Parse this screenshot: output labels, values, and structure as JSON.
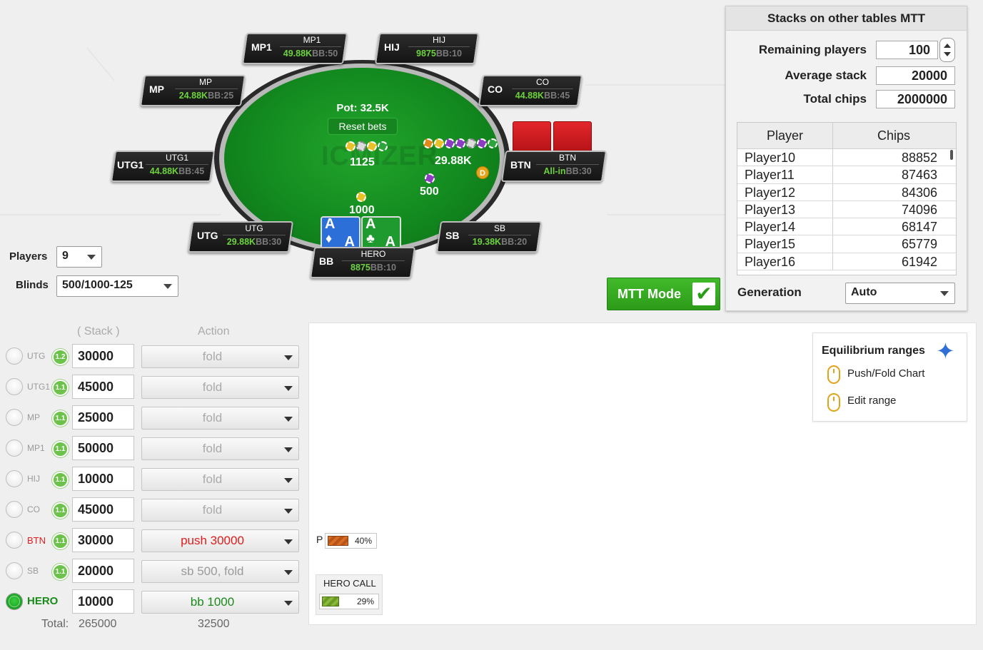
{
  "table": {
    "pot_label": "Pot: 32.5K",
    "reset_label": "Reset bets",
    "logo_text": "ICMIZER",
    "bets": {
      "utg1_area": "1125",
      "btn": "29.88K",
      "sb": "500",
      "bb": "1000"
    },
    "dealer": "D",
    "hero_cards": [
      {
        "rank": "A",
        "suit": "♦",
        "color": "#2d6fd9"
      },
      {
        "rank": "A",
        "suit": "♣",
        "color": "#1f9a2e"
      }
    ]
  },
  "seats": [
    {
      "pos": "MP1",
      "name": "MP1",
      "stack": "49.88K",
      "bb": "BB:50"
    },
    {
      "pos": "HIJ",
      "name": "HIJ",
      "stack": "9875",
      "bb": "BB:10"
    },
    {
      "pos": "MP",
      "name": "MP",
      "stack": "24.88K",
      "bb": "BB:25"
    },
    {
      "pos": "CO",
      "name": "CO",
      "stack": "44.88K",
      "bb": "BB:45"
    },
    {
      "pos": "UTG1",
      "name": "UTG1",
      "stack": "44.88K",
      "bb": "BB:45"
    },
    {
      "pos": "BTN",
      "name": "BTN",
      "stack": "All-in",
      "bb": "BB:30"
    },
    {
      "pos": "UTG",
      "name": "UTG",
      "stack": "29.88K",
      "bb": "BB:30"
    },
    {
      "pos": "SB",
      "name": "SB",
      "stack": "19.38K",
      "bb": "BB:20"
    },
    {
      "pos": "BB",
      "name": "HERO",
      "stack": "8875",
      "bb": "BB:10"
    }
  ],
  "controls": {
    "players_label": "Players",
    "players_value": "9",
    "blinds_label": "Blinds",
    "blinds_value": "500/1000-125",
    "mtt_label": "MTT Mode",
    "mtt_check": "✔"
  },
  "stacks_panel": {
    "title": "Stacks on other tables MTT",
    "remaining_label": "Remaining players",
    "remaining_value": "100",
    "average_label": "Average stack",
    "average_value": "20000",
    "total_label": "Total chips",
    "total_value": "2000000",
    "col_player": "Player",
    "col_chips": "Chips",
    "rows": [
      {
        "player": "Player10",
        "chips": "88852"
      },
      {
        "player": "Player11",
        "chips": "87463"
      },
      {
        "player": "Player12",
        "chips": "84306"
      },
      {
        "player": "Player13",
        "chips": "74096"
      },
      {
        "player": "Player14",
        "chips": "68147"
      },
      {
        "player": "Player15",
        "chips": "65779"
      },
      {
        "player": "Player16",
        "chips": "61942"
      }
    ],
    "generation_label": "Generation",
    "generation_value": "Auto"
  },
  "player_rows": {
    "col_stack": "Stack",
    "col_action": "Action",
    "rows": [
      {
        "pos": "UTG",
        "mult": "1.2",
        "stack": "30000",
        "action": "fold"
      },
      {
        "pos": "UTG1",
        "mult": "1.1",
        "stack": "45000",
        "action": "fold"
      },
      {
        "pos": "MP",
        "mult": "1.1",
        "stack": "25000",
        "action": "fold"
      },
      {
        "pos": "MP1",
        "mult": "1.1",
        "stack": "50000",
        "action": "fold"
      },
      {
        "pos": "HIJ",
        "mult": "1.1",
        "stack": "10000",
        "action": "fold"
      },
      {
        "pos": "CO",
        "mult": "1.1",
        "stack": "45000",
        "action": "fold"
      },
      {
        "pos": "BTN",
        "mult": "1.1",
        "stack": "30000",
        "action": "push 30000"
      },
      {
        "pos": "SB",
        "mult": "1.1",
        "stack": "20000",
        "action": "sb 500, fold"
      },
      {
        "pos": "HERO",
        "mult": "",
        "stack": "10000",
        "action": "bb 1000"
      }
    ],
    "total_label": "Total:",
    "total_stack": "265000",
    "total_action": "32500"
  },
  "ranges": {
    "eq_title": "Equilibrium ranges",
    "pushfold_label": "Push/Fold Chart",
    "edit_label": "Edit range",
    "p_label": "P",
    "p_pct": "40%",
    "p_fraction": 0.4,
    "hero_call_label": "HERO CALL",
    "hero_call_pct": "29%",
    "hero_call_fraction": 0.29
  },
  "icons": [
    "star-icon",
    "mouse-icon",
    "check-icon",
    "dealer-button-icon",
    "caret-down-icon"
  ]
}
